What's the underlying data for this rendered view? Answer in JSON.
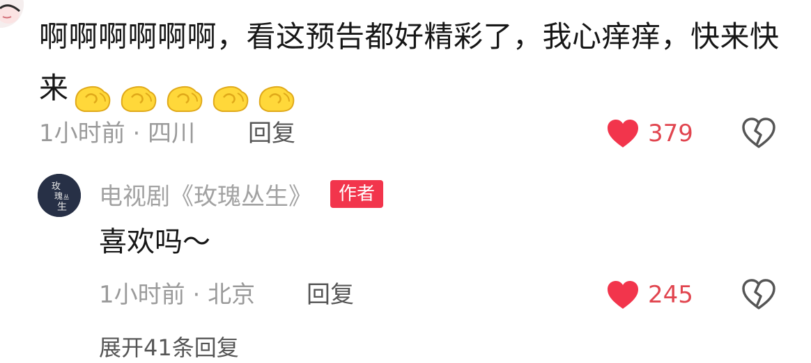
{
  "comment": {
    "text": "啊啊啊啊啊啊，看这预告都好精彩了，我心痒痒，快来快来",
    "emoji": [
      "muscle-emoji",
      "muscle-emoji",
      "muscle-emoji",
      "muscle-emoji",
      "muscle-emoji"
    ],
    "time": "1小时前",
    "separator": "·",
    "location": "四川",
    "reply_label": "回复",
    "like_count": "379"
  },
  "reply": {
    "author": "电视剧《玫瑰丛生》",
    "author_badge": "作者",
    "text": "喜欢吗～",
    "time": "1小时前",
    "separator": "·",
    "location": "北京",
    "reply_label": "回复",
    "like_count": "245",
    "avatar_text": [
      "玫",
      "瑰",
      "丛",
      "生"
    ]
  },
  "expand_label": "展开41条回复",
  "colors": {
    "like": "#f2354c",
    "badge": "#f2354c",
    "meta": "#9a9a9a",
    "body": "#161616"
  }
}
